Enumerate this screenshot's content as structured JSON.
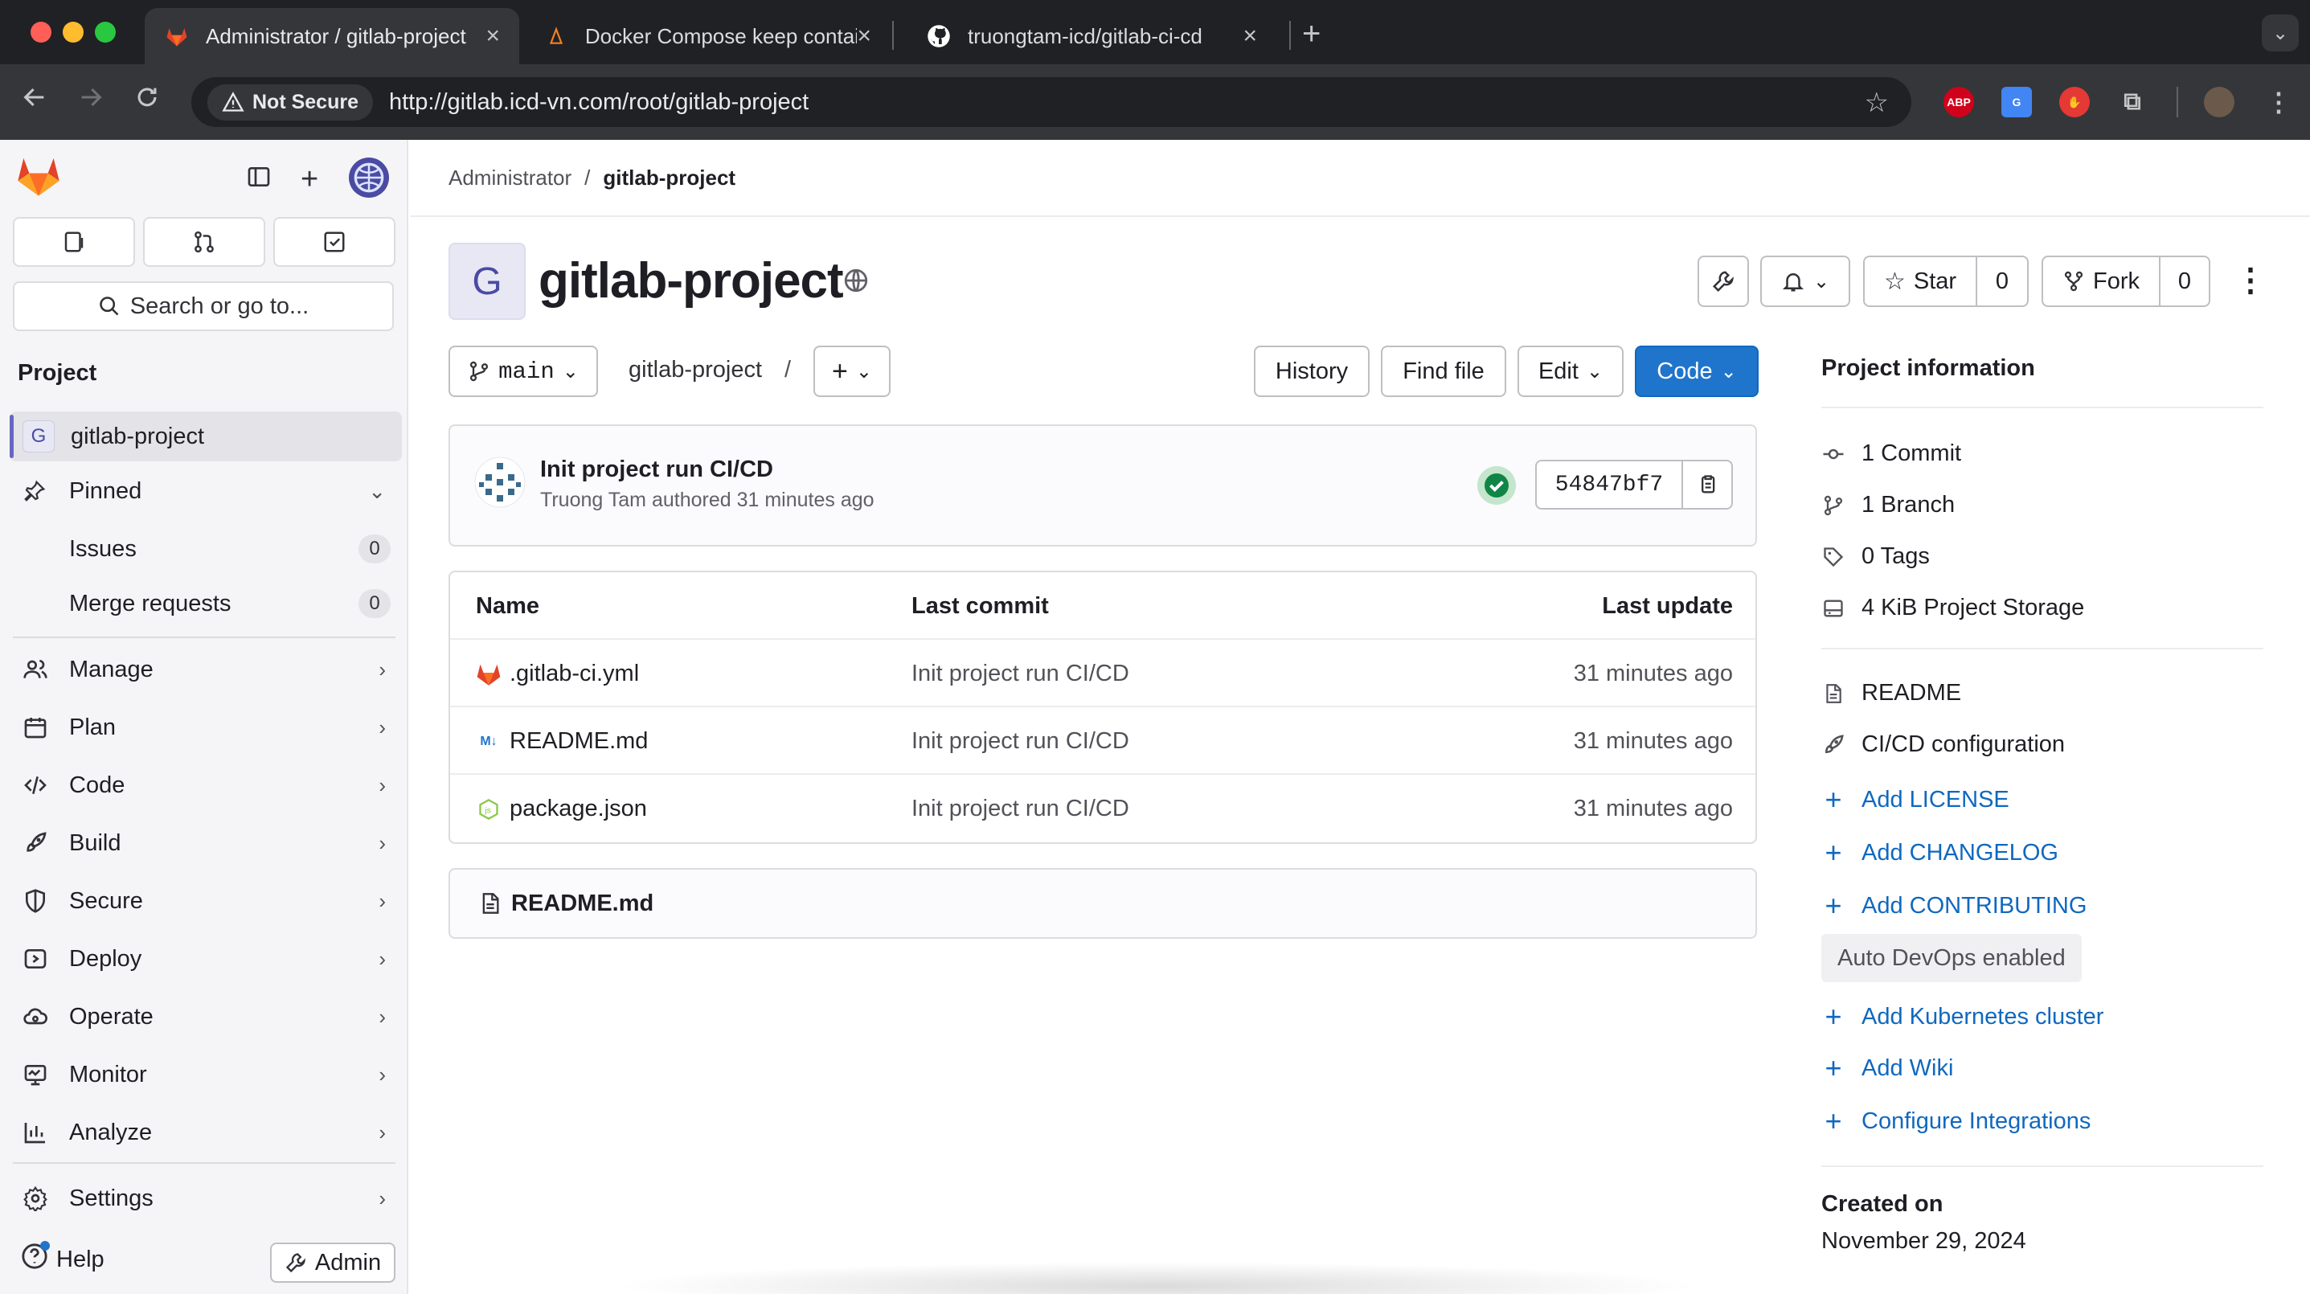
{
  "browser": {
    "tabs": [
      {
        "title": "Administrator / gitlab-project",
        "icon": "gitlab-favicon"
      },
      {
        "title": "Docker Compose keep contai",
        "icon": "docker-favicon"
      },
      {
        "title": "truongtam-icd/gitlab-ci-cd",
        "icon": "github-favicon"
      }
    ],
    "security_label": "Not Secure",
    "url": "http://gitlab.icd-vn.com/root/gitlab-project",
    "extensions": [
      "ABP"
    ]
  },
  "sidebar": {
    "search_label": "Search or go to...",
    "section_heading": "Project",
    "project_name": "gitlab-project",
    "project_initial": "G",
    "pinned_label": "Pinned",
    "pinned_items": [
      {
        "label": "Issues",
        "count": "0"
      },
      {
        "label": "Merge requests",
        "count": "0"
      }
    ],
    "nav": [
      {
        "label": "Manage",
        "icon": "users-icon"
      },
      {
        "label": "Plan",
        "icon": "calendar-icon"
      },
      {
        "label": "Code",
        "icon": "code-icon"
      },
      {
        "label": "Build",
        "icon": "rocket-icon"
      },
      {
        "label": "Secure",
        "icon": "shield-icon"
      },
      {
        "label": "Deploy",
        "icon": "deploy-icon"
      },
      {
        "label": "Operate",
        "icon": "cloud-gear-icon"
      },
      {
        "label": "Monitor",
        "icon": "monitor-icon"
      },
      {
        "label": "Analyze",
        "icon": "chart-icon"
      }
    ],
    "settings_label": "Settings",
    "help_label": "Help",
    "admin_label": "Admin"
  },
  "main": {
    "breadcrumb": [
      "Administrator",
      "gitlab-project"
    ],
    "project_title": "gitlab-project",
    "project_initial": "G",
    "star_label": "Star",
    "star_count": "0",
    "fork_label": "Fork",
    "fork_count": "0",
    "branch": "main",
    "path": "gitlab-project",
    "path_sep": "/",
    "history_label": "History",
    "find_file_label": "Find file",
    "edit_label": "Edit",
    "code_label": "Code",
    "commit": {
      "title": "Init project run CI/CD",
      "meta": "Truong Tam authored 31 minutes ago",
      "sha": "54847bf7",
      "status": "passed"
    },
    "files": {
      "headers": [
        "Name",
        "Last commit",
        "Last update"
      ],
      "rows": [
        {
          "name": ".gitlab-ci.yml",
          "icon": "gitlab-file-icon",
          "commit": "Init project run CI/CD",
          "updated": "31 minutes ago"
        },
        {
          "name": "README.md",
          "icon": "markdown-file-icon",
          "commit": "Init project run CI/CD",
          "updated": "31 minutes ago"
        },
        {
          "name": "package.json",
          "icon": "node-file-icon",
          "commit": "Init project run CI/CD",
          "updated": "31 minutes ago"
        }
      ]
    },
    "readme_header": "README.md"
  },
  "project_info": {
    "heading": "Project information",
    "stats": [
      {
        "label": "1 Commit",
        "icon": "commit-icon"
      },
      {
        "label": "1 Branch",
        "icon": "branch-icon"
      },
      {
        "label": "0 Tags",
        "icon": "tag-icon"
      },
      {
        "label": "4 KiB Project Storage",
        "icon": "storage-icon"
      }
    ],
    "links": [
      {
        "label": "README",
        "icon": "doc-icon"
      },
      {
        "label": "CI/CD configuration",
        "icon": "rocket-icon"
      }
    ],
    "add_links": [
      "Add LICENSE",
      "Add CHANGELOG",
      "Add CONTRIBUTING"
    ],
    "auto_devops": "Auto DevOps enabled",
    "more_links": [
      "Add Kubernetes cluster",
      "Add Wiki",
      "Configure Integrations"
    ],
    "created_label": "Created on",
    "created_date": "November 29, 2024"
  },
  "colors": {
    "primary_button": "#1f75cb",
    "link": "#1068bf",
    "success": "#108548",
    "gitlab_orange": "#e24329"
  }
}
